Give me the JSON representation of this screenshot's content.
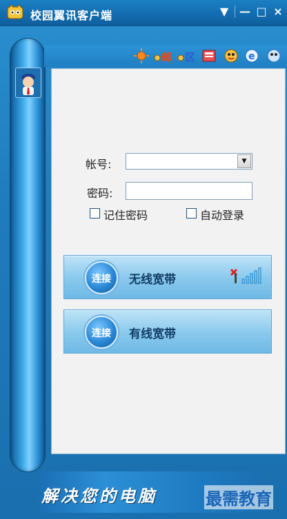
{
  "window": {
    "title": "校园翼讯客户端"
  },
  "titlebar": {
    "buttons": [
      {
        "name": "dropdown",
        "glyph": "▼"
      },
      {
        "name": "minimize",
        "glyph": "—"
      },
      {
        "name": "maximize",
        "glyph": "□"
      },
      {
        "name": "close",
        "glyph": "×"
      }
    ]
  },
  "toolbar": {
    "icons": [
      {
        "name": "settings-sun-icon"
      },
      {
        "name": "mail-icon",
        "text": "邮"
      },
      {
        "name": "zone-icon",
        "text": "区"
      },
      {
        "name": "news-icon"
      },
      {
        "name": "qq-icon"
      },
      {
        "name": "ie-icon"
      },
      {
        "name": "game-icon"
      }
    ]
  },
  "form": {
    "account_label": "帐号:",
    "account_value": "",
    "password_label": "密码:",
    "password_value": "",
    "remember_label": "记住密码",
    "autologin_label": "自动登录"
  },
  "connections": [
    {
      "circle_text": "连接",
      "label": "无线宽带"
    },
    {
      "circle_text": "连接",
      "label": "有线宽带"
    }
  ],
  "footer": {
    "banner_text": "解决您的电脑",
    "watermark": "最需教育"
  },
  "colors": {
    "title_bg": "#136bad",
    "panel_bg": "#f2f2f2",
    "accent": "#1f7cc2"
  }
}
